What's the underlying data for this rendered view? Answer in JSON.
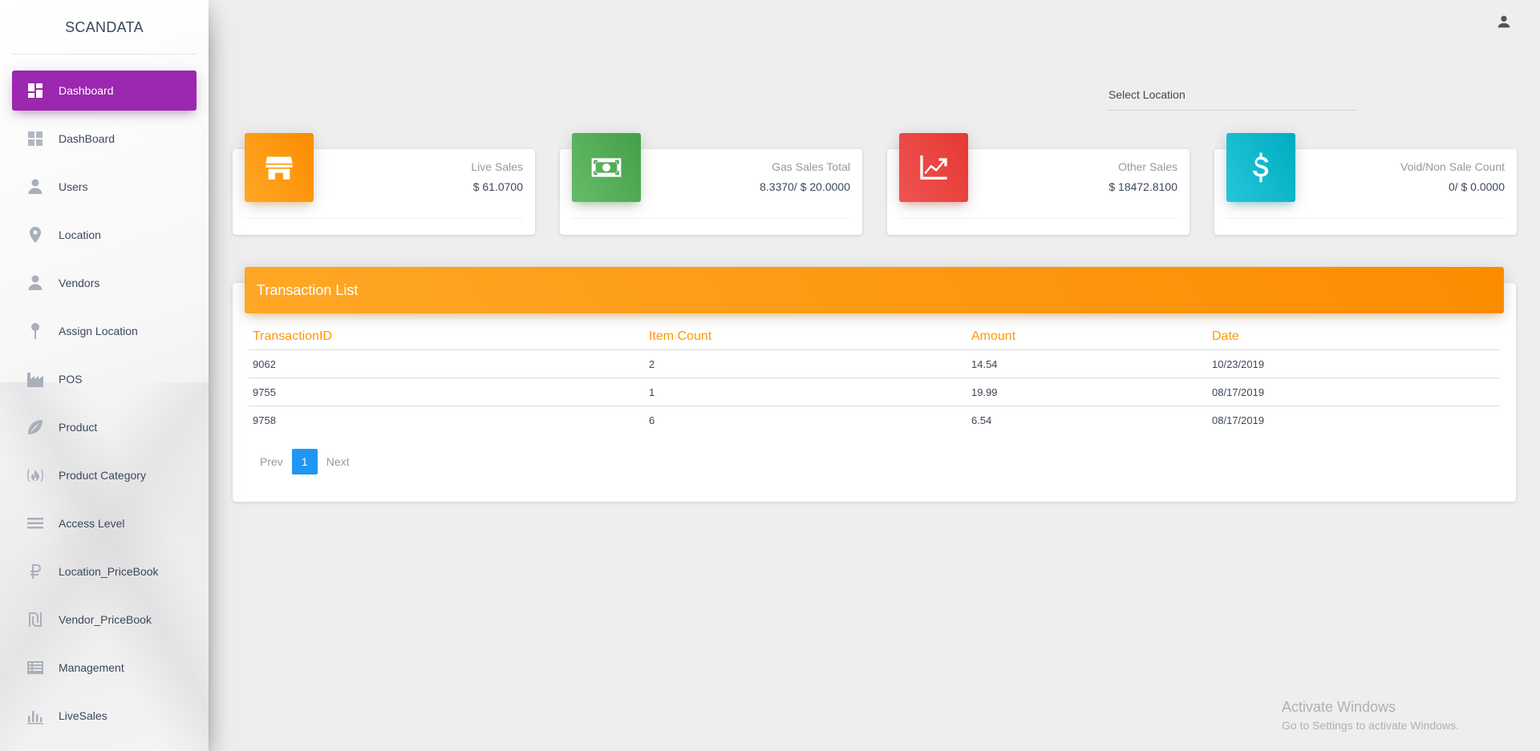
{
  "brand": "SCANDATA",
  "sidebar": {
    "items": [
      {
        "label": "Dashboard",
        "icon": "dashboard-icon",
        "active": true
      },
      {
        "label": "DashBoard",
        "icon": "dashboard-icon"
      },
      {
        "label": "Users",
        "icon": "person-icon"
      },
      {
        "label": "Location",
        "icon": "location-pin-icon"
      },
      {
        "label": "Vendors",
        "icon": "person-icon"
      },
      {
        "label": "Assign Location",
        "icon": "pin-icon"
      },
      {
        "label": "POS",
        "icon": "factory-icon"
      },
      {
        "label": "Product",
        "icon": "leaf-icon"
      },
      {
        "label": "Product Category",
        "icon": "fire-icon"
      },
      {
        "label": "Access Level",
        "icon": "list-icon"
      },
      {
        "label": "Location_PriceBook",
        "icon": "ruble-icon"
      },
      {
        "label": "Vendor_PriceBook",
        "icon": "shekel-icon"
      },
      {
        "label": "Management",
        "icon": "table-icon"
      },
      {
        "label": "LiveSales",
        "icon": "bar-chart-icon"
      }
    ]
  },
  "header": {
    "location_label": "Select Location",
    "user_icon": "person-icon"
  },
  "stats": [
    {
      "title": "Live Sales",
      "value": "$ 61.0700",
      "icon": "store-icon",
      "color": "#fb8c00"
    },
    {
      "title": "Gas Sales Total",
      "value": "8.3370/ $ 20.0000",
      "icon": "money-icon",
      "color": "#43a047"
    },
    {
      "title": "Other Sales",
      "value": "$ 18472.8100",
      "icon": "trending-up-icon",
      "color": "#e53935"
    },
    {
      "title": "Void/Non Sale Count",
      "value": "0/ $ 0.0000",
      "icon": "dollar-icon",
      "color": "#00acc1"
    }
  ],
  "transactions": {
    "title": "Transaction List",
    "columns": [
      "TransactionID",
      "Item Count",
      "Amount",
      "Date"
    ],
    "rows": [
      [
        "9062",
        "2",
        "14.54",
        "10/23/2019"
      ],
      [
        "9755",
        "1",
        "19.99",
        "08/17/2019"
      ],
      [
        "9758",
        "6",
        "6.54",
        "08/17/2019"
      ]
    ],
    "pager": {
      "prev": "Prev",
      "page": "1",
      "next": "Next"
    }
  },
  "watermark": {
    "line1": "Activate Windows",
    "line2": "Go to Settings to activate Windows."
  }
}
